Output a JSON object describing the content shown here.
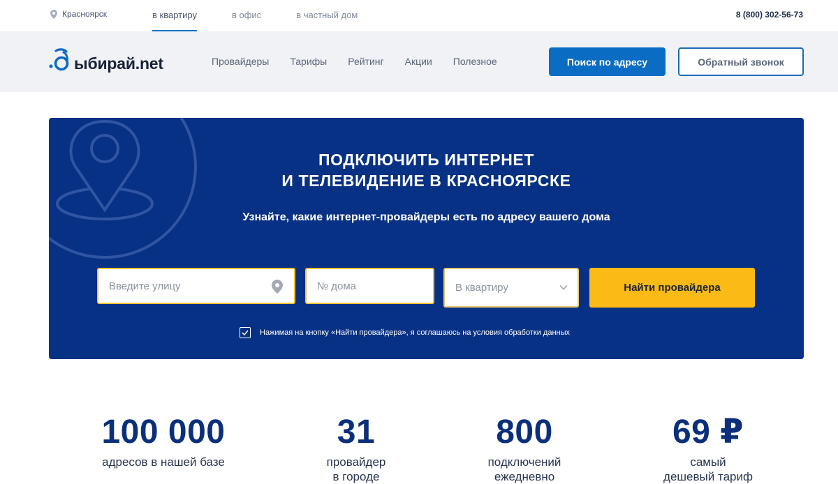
{
  "topbar": {
    "city": "Красноярск",
    "tabs": [
      {
        "label": "в квартиру",
        "active": true
      },
      {
        "label": "в офис",
        "active": false
      },
      {
        "label": "в частный дом",
        "active": false
      }
    ],
    "phone": "8 (800) 302-56-73"
  },
  "header": {
    "logo_text": "ыбирай.net",
    "nav": [
      "Провайдеры",
      "Тарифы",
      "Рейтинг",
      "Акции",
      "Полезное"
    ],
    "search_button": "Поиск по адресу",
    "callback_button": "Обратный звонок"
  },
  "hero": {
    "title_line1": "ПОДКЛЮЧИТЬ ИНТЕРНЕТ",
    "title_line2": "И ТЕЛЕВИДЕНИЕ В КРАСНОЯРСКЕ",
    "subtitle": "Узнайте, какие интернет-провайдеры есть по адресу вашего дома",
    "street_placeholder": "Введите улицу",
    "house_placeholder": "№ дома",
    "type_select": "В квартиру",
    "find_button": "Найти провайдера",
    "consent": "Нажимая на кнопку «Найти провайдера», я соглашаюсь на условия обработки данных",
    "consent_checked": true
  },
  "stats": [
    {
      "value": "100 000",
      "label_line1": "адресов в нашей базе",
      "label_line2": ""
    },
    {
      "value": "31",
      "label_line1": "провайдер",
      "label_line2": "в городе"
    },
    {
      "value": "800",
      "label_line1": "подключений",
      "label_line2": "ежедневно"
    },
    {
      "value": "69 ₽",
      "label_line1": "самый",
      "label_line2": "дешевый тариф"
    }
  ],
  "colors": {
    "brand_blue": "#0b6cc4",
    "hero_bg": "#073185",
    "accent_yellow": "#fbba16",
    "stat_blue": "#0b2f7a"
  }
}
